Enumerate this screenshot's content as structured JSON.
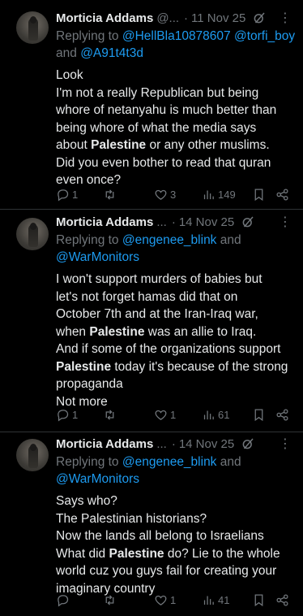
{
  "tweets": [
    {
      "name": "Morticia Addams",
      "handle": "@...",
      "sep": "·",
      "time": "11 Nov 25",
      "replying_prefix": "Replying to",
      "mentions_line1": "@HellBla10878607 @torfi_boy",
      "and_word": "and",
      "mention_last": "@A91t4t3d",
      "body": [
        [
          {
            "t": "Look"
          }
        ],
        [
          {
            "t": "I'm not a really Republican but being"
          }
        ],
        [
          {
            "t": "whore of netanyahu is much better than"
          }
        ],
        [
          {
            "t": "being whore of what the media says"
          }
        ],
        [
          {
            "t": "about "
          },
          {
            "t": "Palestine",
            "b": true
          },
          {
            "t": " or any other muslims."
          }
        ],
        [
          {
            "t": "Did you even bother to read that quran"
          }
        ],
        [
          {
            "t": "even once?"
          }
        ]
      ],
      "reply_count": "1",
      "retweet_count": "",
      "like_count": "3",
      "view_count": "149"
    },
    {
      "name": "Morticia Addams",
      "handle": "...",
      "sep": "·",
      "time": "14 Nov 25",
      "replying_prefix": "Replying to",
      "mention_1": "@engenee_blink",
      "and_word": "and",
      "mention_2": "@WarMonitors",
      "body": [
        [
          {
            "t": "I won't support murders of babies but"
          }
        ],
        [
          {
            "t": "let's not forget hamas did that on"
          }
        ],
        [
          {
            "t": "October 7th and at the Iran-Iraq war,"
          }
        ],
        [
          {
            "t": "when "
          },
          {
            "t": "Palestine",
            "b": true
          },
          {
            "t": " was an allie to Iraq."
          }
        ],
        [
          {
            "t": "And if some of the organizations support"
          }
        ],
        [
          {
            "t": "Palestine",
            "b": true
          },
          {
            "t": " today it's because of the strong"
          }
        ],
        [
          {
            "t": "propaganda"
          }
        ],
        [
          {
            "t": "Not more"
          }
        ]
      ],
      "reply_count": "1",
      "retweet_count": "",
      "like_count": "1",
      "view_count": "61"
    },
    {
      "name": "Morticia Addams",
      "handle": "...",
      "sep": "·",
      "time": "14 Nov 25",
      "replying_prefix": "Replying to",
      "mention_1": "@engenee_blink",
      "and_word": "and",
      "mention_2": "@WarMonitors",
      "body": [
        [
          {
            "t": "Says who?"
          }
        ],
        [
          {
            "t": "The Palestinian historians?"
          }
        ],
        [
          {
            "t": "Now the lands all belong to Israelians"
          }
        ],
        [
          {
            "t": "What did "
          },
          {
            "t": "Palestine",
            "b": true
          },
          {
            "t": " do? Lie to the whole"
          }
        ],
        [
          {
            "t": "world cuz you guys fail for creating your"
          }
        ],
        [
          {
            "t": "imaginary country"
          }
        ]
      ],
      "reply_count": "",
      "retweet_count": "",
      "like_count": "1",
      "view_count": "41"
    }
  ],
  "icons": {
    "more": "more-dots-icon",
    "grok": "grok-icon",
    "reply": "reply-icon",
    "retweet": "retweet-icon",
    "like": "heart-icon",
    "views": "views-chart-icon",
    "bookmark": "bookmark-icon",
    "share": "share-icon"
  },
  "colors": {
    "background": "#000000",
    "text": "#e7e9ea",
    "muted": "#71767b",
    "link": "#1d9bf0",
    "divider": "#2f3336"
  }
}
